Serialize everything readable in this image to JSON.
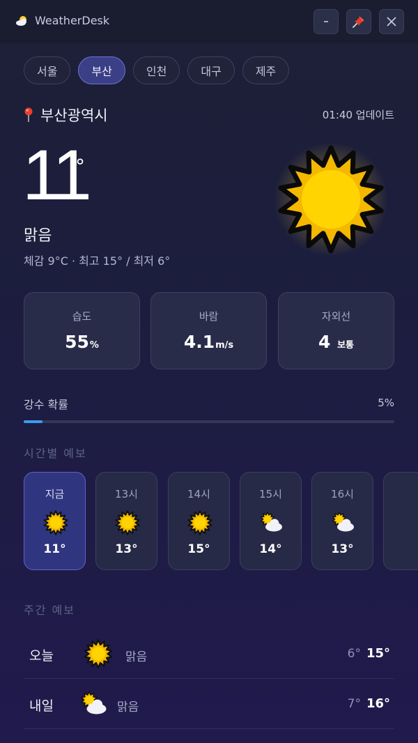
{
  "window": {
    "title": "WeatherDesk"
  },
  "cities": [
    {
      "label": "서울",
      "active": false
    },
    {
      "label": "부산",
      "active": true
    },
    {
      "label": "인천",
      "active": false
    },
    {
      "label": "대구",
      "active": false
    },
    {
      "label": "제주",
      "active": false
    }
  ],
  "current": {
    "location": "부산광역시",
    "updated": "01:40 업데이트",
    "temp": "11",
    "degree_symbol": "°",
    "condition": "맑음",
    "feels_line": "체감 9°C · 최고 15° / 최저 6°",
    "icon": "sun-icon"
  },
  "stats": {
    "humidity": {
      "label": "습도",
      "value": "55",
      "unit": "%"
    },
    "wind": {
      "label": "바람",
      "value": "4.1",
      "unit": "m/s"
    },
    "uv": {
      "label": "자외선",
      "value": "4",
      "unit": "보통"
    }
  },
  "rain": {
    "label": "강수 확률",
    "value": "5%",
    "percent": 5
  },
  "hourly": {
    "title": "시간별 예보",
    "items": [
      {
        "time": "지금",
        "temp": "11°",
        "icon": "sun-icon",
        "active": true
      },
      {
        "time": "13시",
        "temp": "13°",
        "icon": "sun-icon",
        "active": false
      },
      {
        "time": "14시",
        "temp": "15°",
        "icon": "sun-icon",
        "active": false
      },
      {
        "time": "15시",
        "temp": "14°",
        "icon": "partly-cloudy-icon",
        "active": false
      },
      {
        "time": "16시",
        "temp": "13°",
        "icon": "partly-cloudy-icon",
        "active": false
      }
    ]
  },
  "weekly": {
    "title": "주간 예보",
    "days": [
      {
        "day": "오늘",
        "condition": "맑음",
        "low": "6°",
        "high": "15°",
        "icon": "sun-icon"
      },
      {
        "day": "내일",
        "condition": "맑음",
        "low": "7°",
        "high": "16°",
        "icon": "partly-cloudy-icon"
      }
    ]
  },
  "colors": {
    "accent": "#5d62cf",
    "sun": "#ffd21a",
    "rain_bar": "#3b9cf0",
    "background": "#1c1d3f"
  }
}
